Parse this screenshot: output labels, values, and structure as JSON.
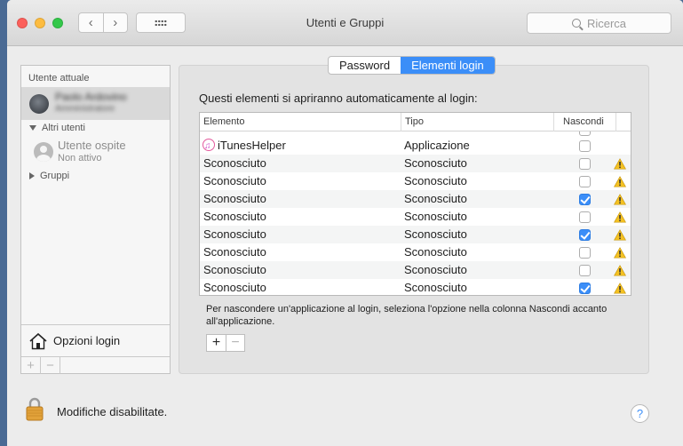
{
  "window": {
    "title": "Utenti e Gruppi"
  },
  "toolbar": {
    "back_icon": "chevron-left-icon",
    "forward_icon": "chevron-right-icon",
    "show_all_icon": "grid-icon"
  },
  "search": {
    "placeholder": "Ricerca"
  },
  "sidebar": {
    "current_user_header": "Utente attuale",
    "current_user": {
      "name": "Paolo Ardovino",
      "role": "Amministratore"
    },
    "other_users_header": "Altri utenti",
    "guest_user": {
      "name": "Utente ospite",
      "status": "Non attivo"
    },
    "groups_header": "Gruppi",
    "login_options_label": "Opzioni login",
    "add_label": "+",
    "remove_label": "−"
  },
  "tabs": [
    {
      "label": "Password",
      "active": false
    },
    {
      "label": "Elementi login",
      "active": true
    }
  ],
  "login_items": {
    "instructions": "Questi elementi si apriranno automaticamente al login:",
    "columns": {
      "item": "Elemento",
      "type": "Tipo",
      "hide": "Nascondi"
    },
    "rows": [
      {
        "item": "iTunesHelper",
        "type": "Applicazione",
        "hide": false,
        "warning": false
      },
      {
        "item": "Sconosciuto",
        "type": "Sconosciuto",
        "hide": false,
        "warning": true
      },
      {
        "item": "Sconosciuto",
        "type": "Sconosciuto",
        "hide": false,
        "warning": true
      },
      {
        "item": "Sconosciuto",
        "type": "Sconosciuto",
        "hide": true,
        "warning": true
      },
      {
        "item": "Sconosciuto",
        "type": "Sconosciuto",
        "hide": false,
        "warning": true
      },
      {
        "item": "Sconosciuto",
        "type": "Sconosciuto",
        "hide": true,
        "warning": true
      },
      {
        "item": "Sconosciuto",
        "type": "Sconosciuto",
        "hide": false,
        "warning": true
      },
      {
        "item": "Sconosciuto",
        "type": "Sconosciuto",
        "hide": false,
        "warning": true
      },
      {
        "item": "Sconosciuto",
        "type": "Sconosciuto",
        "hide": true,
        "warning": true
      }
    ],
    "help_text": "Per nascondere un'applicazione al login, seleziona l'opzione nella colonna Nascondi accanto all'applicazione.",
    "add_label": "+",
    "remove_label": "−"
  },
  "footer": {
    "lock_status": "Modifiche disabilitate.",
    "help_label": "?"
  },
  "colors": {
    "accent": "#3b8ef8",
    "warning": "#f5c222"
  }
}
